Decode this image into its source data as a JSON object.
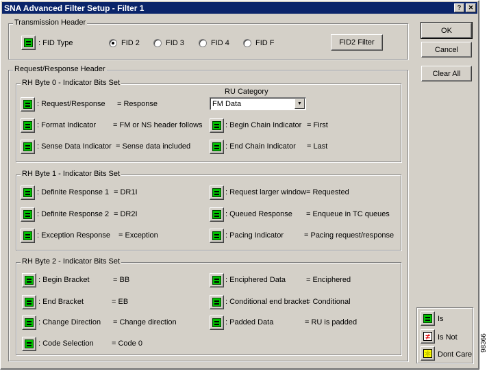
{
  "window": {
    "title": "SNA Advanced Filter Setup - Filter 1",
    "help_btn": "?",
    "close_btn": "✕"
  },
  "transmission": {
    "title": "Transmission Header",
    "fid_label": ": FID Type",
    "radios": [
      {
        "label": "FID 2",
        "selected": true
      },
      {
        "label": "FID 3",
        "selected": false
      },
      {
        "label": "FID 4",
        "selected": false
      },
      {
        "label": "FID F",
        "selected": false
      }
    ],
    "fid2_button": "FID2 Filter"
  },
  "rr": {
    "title": "Request/Response Header"
  },
  "byte0": {
    "title": "RH Byte 0 - Indicator Bits Set",
    "ru_label": "RU Category",
    "ru_value": "FM Data",
    "left": [
      {
        "label": ": Request/Response",
        "value": "= Response"
      },
      {
        "label": ": Format Indicator",
        "value": "= FM or NS header follows"
      },
      {
        "label": ": Sense Data Indicator",
        "value": "= Sense data included"
      }
    ],
    "right": [
      {
        "label": ": Begin Chain Indicator",
        "value": "= First"
      },
      {
        "label": ": End Chain Indicator",
        "value": "= Last"
      }
    ]
  },
  "byte1": {
    "title": "RH Byte 1 - Indicator Bits Set",
    "left": [
      {
        "label": ": Definite Response 1",
        "value": "= DR1I"
      },
      {
        "label": ": Definite Response 2",
        "value": "= DR2I"
      },
      {
        "label": ": Exception Response",
        "value": "= Exception"
      }
    ],
    "right": [
      {
        "label": ": Request larger window",
        "value": "= Requested"
      },
      {
        "label": ": Queued Response",
        "value": "= Enqueue in TC queues"
      },
      {
        "label": ": Pacing Indicator",
        "value": "= Pacing request/response"
      }
    ]
  },
  "byte2": {
    "title": "RH Byte 2 - Indicator Bits Set",
    "left": [
      {
        "label": ": Begin Bracket",
        "value": "= BB"
      },
      {
        "label": ": End Bracket",
        "value": "= EB"
      },
      {
        "label": ": Change Direction",
        "value": "= Change direction"
      },
      {
        "label": ": Code Selection",
        "value": "= Code 0"
      }
    ],
    "right": [
      {
        "label": ": Enciphered Data",
        "value": "= Enciphered"
      },
      {
        "label": ": Conditional end bracket",
        "value": "= Conditional"
      },
      {
        "label": ": Padded Data",
        "value": "= RU is padded"
      }
    ]
  },
  "buttons": {
    "ok": "OK",
    "cancel": "Cancel",
    "clear_all": "Clear All"
  },
  "legend": {
    "is": "Is",
    "is_not": "Is Not",
    "dont_care": "Dont Care",
    "neq_glyph": "≠",
    "dc_glyph": "✱"
  },
  "figure_id": "98366"
}
